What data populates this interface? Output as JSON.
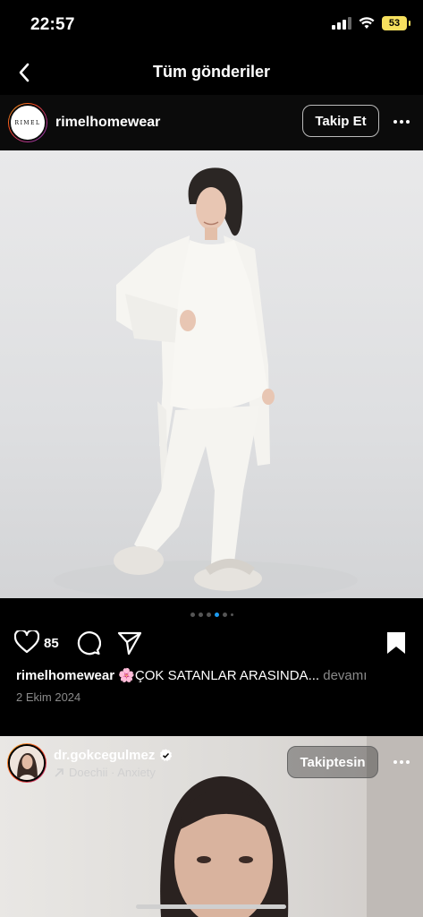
{
  "status_bar": {
    "time": "22:57",
    "battery": "53"
  },
  "nav": {
    "title": "Tüm gönderiler"
  },
  "post": {
    "username": "rimelhomewear",
    "avatar_text": "RIMEL",
    "follow_label": "Takip Et",
    "likes": "85",
    "caption_user": "rimelhomewear",
    "caption_emoji": "🌸",
    "caption_text": "ÇOK SATANLAR ARASINDA...",
    "caption_more": "devamı",
    "date": "2 Ekim 2024",
    "carousel": {
      "count": 6,
      "active_index": 3
    }
  },
  "next_post": {
    "username": "dr.gokcegulmez",
    "music": "Doechii · Anxiety",
    "following_label": "Takiptesin"
  }
}
